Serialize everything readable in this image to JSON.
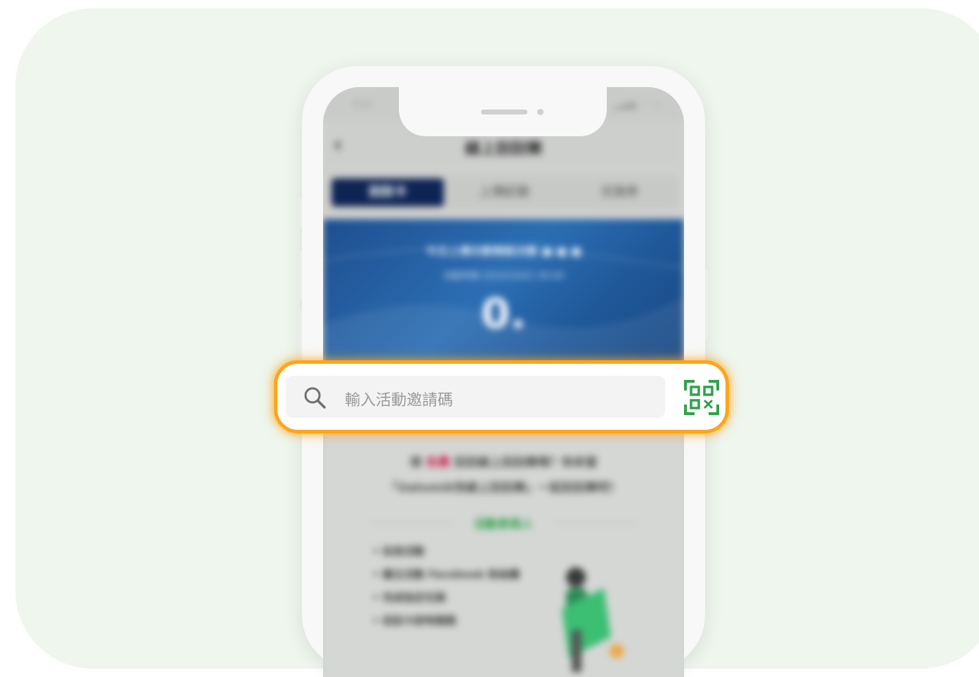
{
  "status_bar": {
    "time": "9:41",
    "icons": "▂▄▆ ◠ ▭"
  },
  "nav": {
    "back_icon": "chevron-left-icon",
    "back_glyph": "‹",
    "title": "線上刮刮樂"
  },
  "tabs": [
    {
      "label": "刮刮卡",
      "active": true
    },
    {
      "label": "上傳紀錄",
      "active": false
    },
    {
      "label": "兌換券",
      "active": false
    }
  ],
  "banner": {
    "line1": "今日上傳次數剩餘次數 ■ ■ ■",
    "line2": "活動時間 2023/10/01 00:00",
    "amount": "0."
  },
  "search": {
    "placeholder": "輸入活動邀請碼",
    "search_icon": "search-icon",
    "scan_icon": "qr-scan-icon",
    "accent_color": "#ffa51a"
  },
  "content": {
    "desc_prefix": "想",
    "desc_free": "免費",
    "desc_rest": "刮刮線上刮刮樂嗎？快來當",
    "desc_line2": "「Uatomik快線上刮刮樂」一起刮刮樂吧！",
    "section_title": "活動參與人",
    "features": [
      "• 註冊活動",
      "• 關注活動 Facebook 粉絲團",
      "• 完成指定任務",
      "• 刮刮卡即時開獎"
    ]
  },
  "colors": {
    "background": "#eef6ee",
    "brand_navy": "#0e2455",
    "brand_green": "#2ea24a"
  }
}
